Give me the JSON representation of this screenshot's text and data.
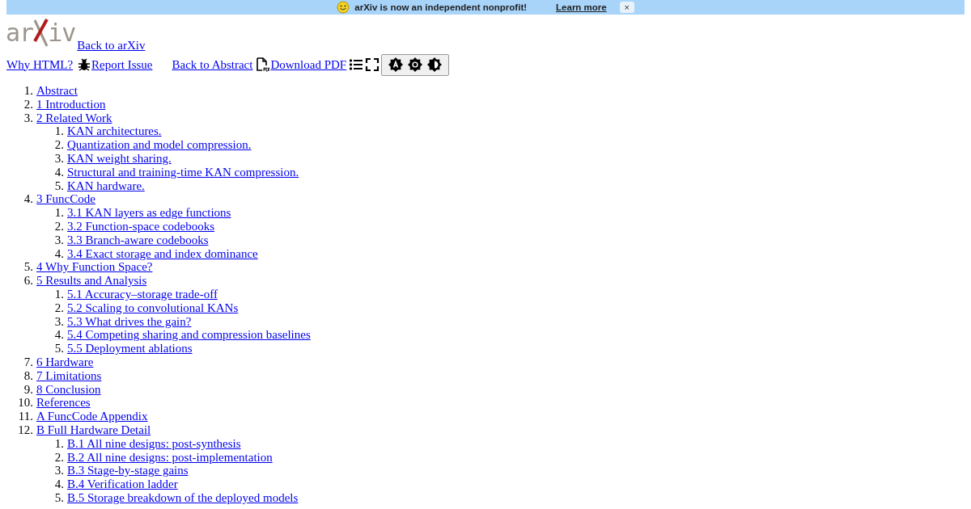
{
  "banner": {
    "message": "arXiv is now an independent nonprofit!",
    "link": "Learn more",
    "close": "×"
  },
  "header": {
    "logo": {
      "left": "ar",
      "right": "iv"
    },
    "back_to_arxiv": "Back to arXiv",
    "why_html": "Why HTML?",
    "report_issue": "Report Issue",
    "back_to_abstract": "Back to Abstract",
    "download_pdf": "Download PDF"
  },
  "toc": [
    {
      "number": "1.",
      "label": "Abstract"
    },
    {
      "number": "2.",
      "label": "1 Introduction"
    },
    {
      "number": "3.",
      "label": "2 Related Work",
      "children": [
        {
          "number": "1.",
          "label": "KAN architectures."
        },
        {
          "number": "2.",
          "label": "Quantization and model compression."
        },
        {
          "number": "3.",
          "label": "KAN weight sharing."
        },
        {
          "number": "4.",
          "label": "Structural and training-time KAN compression."
        },
        {
          "number": "5.",
          "label": "KAN hardware."
        }
      ]
    },
    {
      "number": "4.",
      "label": "3 FuncCode",
      "children": [
        {
          "number": "1.",
          "label": "3.1 KAN layers as edge functions"
        },
        {
          "number": "2.",
          "label": "3.2 Function-space codebooks"
        },
        {
          "number": "3.",
          "label": "3.3 Branch-aware codebooks"
        },
        {
          "number": "4.",
          "label": "3.4 Exact storage and index dominance"
        }
      ]
    },
    {
      "number": "5.",
      "label": "4 Why Function Space?"
    },
    {
      "number": "6.",
      "label": "5 Results and Analysis",
      "children": [
        {
          "number": "1.",
          "label": "5.1 Accuracy–storage trade-off"
        },
        {
          "number": "2.",
          "label": "5.2 Scaling to convolutional KANs"
        },
        {
          "number": "3.",
          "label": "5.3 What drives the gain?"
        },
        {
          "number": "4.",
          "label": "5.4 Competing sharing and compression baselines"
        },
        {
          "number": "5.",
          "label": "5.5 Deployment ablations"
        }
      ]
    },
    {
      "number": "7.",
      "label": "6 Hardware"
    },
    {
      "number": "8.",
      "label": "7 Limitations"
    },
    {
      "number": "9.",
      "label": "8 Conclusion"
    },
    {
      "number": "10.",
      "label": "References"
    },
    {
      "number": "11.",
      "label": "A FuncCode Appendix"
    },
    {
      "number": "12.",
      "label": "B Full Hardware Detail",
      "children": [
        {
          "number": "1.",
          "label": "B.1 All nine designs: post-synthesis"
        },
        {
          "number": "2.",
          "label": "B.2 All nine designs: post-implementation"
        },
        {
          "number": "3.",
          "label": "B.3 Stage-by-stage gains"
        },
        {
          "number": "4.",
          "label": "B.4 Verification ladder"
        },
        {
          "number": "5.",
          "label": "B.5 Storage breakdown of the deployed models"
        }
      ]
    }
  ]
}
